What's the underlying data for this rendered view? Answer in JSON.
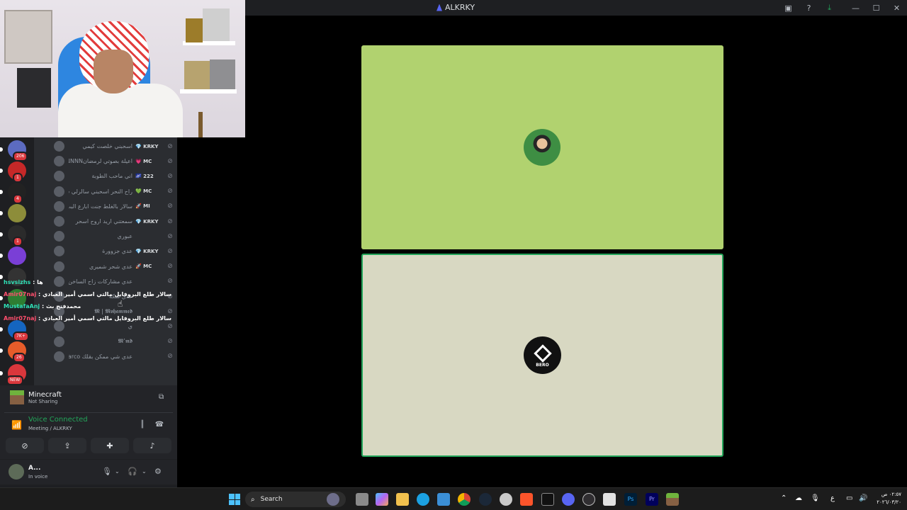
{
  "window": {
    "title": "ALKRKY"
  },
  "servers": [
    {
      "badge": "206",
      "color": "#5c6bc0"
    },
    {
      "badge": "1",
      "color": "#c62828"
    },
    {
      "badge": "4",
      "color": "#222222"
    },
    {
      "badge": "",
      "color": "#8d8d3a"
    },
    {
      "badge": "1",
      "color": "#2b2b2b"
    },
    {
      "badge": "",
      "color": "#7a3fd6"
    },
    {
      "badge": "",
      "color": "#333333"
    },
    {
      "badge": "",
      "color": "#2e7d32"
    },
    {
      "badge": "7K+",
      "color": "#1565c0"
    },
    {
      "badge": "26",
      "color": "#e65c2a"
    },
    {
      "badge": "NEW",
      "color": "#da373c"
    }
  ],
  "members": [
    {
      "name": "اسحبني خلصت كيمي",
      "tag": "💎 KRKY"
    },
    {
      "name": "اعيلة بصوتي لرمضانNNNNNNN",
      "tag": "💗 MC"
    },
    {
      "name": "اني ماحب الطوبة",
      "tag": "🌌 222"
    },
    {
      "name": "راح النحر اسحبني سالرلي ساعه",
      "tag": "💚 MC"
    },
    {
      "name": "سالار بالغلط جنت ابارع البث مالك",
      "tag": "🚀 MI"
    },
    {
      "name": "سمعتني اريد اروح اسحر",
      "tag": "💎 KRKY"
    },
    {
      "name": "عبوري",
      "tag": ""
    },
    {
      "name": "عدي جزوورة",
      "tag": "💎 KRKY"
    },
    {
      "name": "عدي شحر شميري",
      "tag": "🚀 MC"
    },
    {
      "name": "عدي مشاركات زاح الساخن و ماهمسد",
      "tag": ""
    },
    {
      "name": "عدي شكه",
      "tag": ""
    },
    {
      "name": "𝕸 | 𝕸𝖔𝖍𝖆𝖒𝖒𝖊𝖉",
      "tag": ""
    },
    {
      "name": "ي",
      "tag": ""
    },
    {
      "name": "𝕸’𝖒𝖉",
      "tag": ""
    },
    {
      "name": "عدي شي ممكن بقلك Marco 😍 🙂",
      "tag": ""
    }
  ],
  "chat": [
    {
      "user": "hsvsizhs",
      "user_color": "#2fe0b6",
      "message": ": ها"
    },
    {
      "user": "Amir07naj",
      "user_color": "#ff4f6d",
      "message": ": سالار طلع البروفايل مالتي اسمي أمير العبادي"
    },
    {
      "user": "MustafaAnj",
      "user_color": "#2fe0b6",
      "message": ": محمدفتح بث"
    },
    {
      "user": "Amir07naj",
      "user_color": "#ff4f6d",
      "message": ": سالار طلع البروفايل مالتي اسمي أمير العبادي"
    }
  ],
  "activity": {
    "title": "Minecraft",
    "subtitle": "Not Sharing"
  },
  "voice": {
    "title": "Voice Connected",
    "subtitle": "Meeting / ALKRKY"
  },
  "user": {
    "name": "A...",
    "status": "In voice"
  },
  "call": {
    "tile2_label": "BERO"
  },
  "taskbar": {
    "search_label": "Search",
    "clock_time": "٠٢:٥٧ ص",
    "clock_date": "٢٠٢٦/٠٣/٢٠",
    "lang": "ع"
  },
  "colors": {
    "accent": "#23a55a",
    "tile_green": "#b1d26f",
    "tile_beige": "#d8d8c2"
  }
}
